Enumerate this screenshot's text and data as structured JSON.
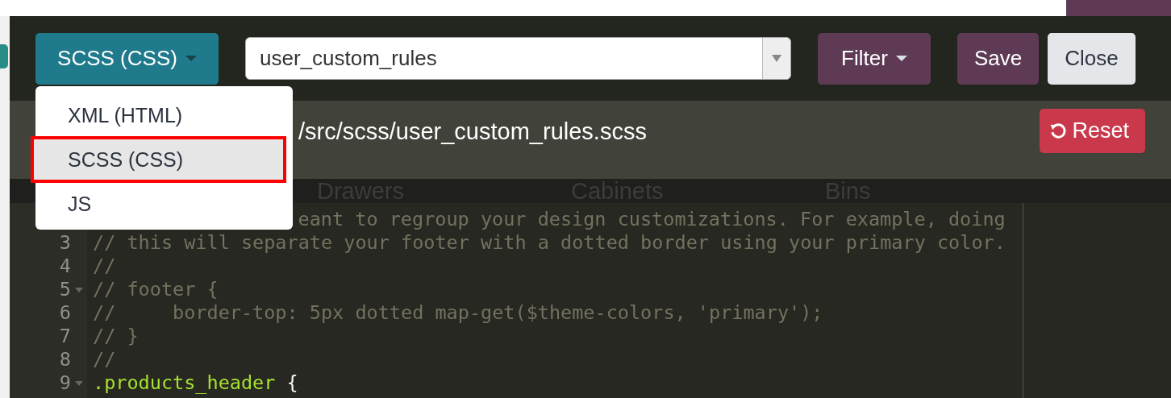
{
  "toolbar": {
    "language_button": {
      "label": "SCSS (CSS)"
    },
    "file_select": {
      "value": "user_custom_rules"
    },
    "buttons": [
      {
        "label": "Filter",
        "kind": "dropdown"
      },
      {
        "label": "Save",
        "kind": "primary"
      },
      {
        "label": "Close",
        "kind": "secondary"
      }
    ]
  },
  "language_menu": {
    "items": [
      {
        "label": "XML (HTML)",
        "selected": false,
        "highlighted": false
      },
      {
        "label": "SCSS (CSS)",
        "selected": true,
        "highlighted": true
      },
      {
        "label": "JS",
        "selected": false,
        "highlighted": false
      }
    ]
  },
  "file_path": "/src/scss/user_custom_rules.scss",
  "reset_button": {
    "label": "Reset"
  },
  "background_categories": [
    "Drawers",
    "Cabinets",
    "Bins"
  ],
  "editor": {
    "lines": [
      {
        "tokens": [
          {
            "text": "eant to regroup your design customizations. For example, doing",
            "kind": "comment"
          }
        ],
        "foldable": false,
        "offset": true
      },
      {
        "number": "3",
        "tokens": [
          {
            "text": "// this will separate your footer with a dotted border using your primary color.",
            "kind": "comment"
          }
        ],
        "foldable": false
      },
      {
        "number": "4",
        "tokens": [
          {
            "text": "//",
            "kind": "comment"
          }
        ],
        "foldable": false
      },
      {
        "number": "5",
        "tokens": [
          {
            "text": "// footer {",
            "kind": "comment"
          }
        ],
        "foldable": true
      },
      {
        "number": "6",
        "tokens": [
          {
            "text": "//     border-top: 5px dotted map-get($theme-colors, 'primary');",
            "kind": "comment"
          }
        ],
        "foldable": false
      },
      {
        "number": "7",
        "tokens": [
          {
            "text": "// }",
            "kind": "comment"
          }
        ],
        "foldable": false
      },
      {
        "number": "8",
        "tokens": [
          {
            "text": "//",
            "kind": "comment"
          }
        ],
        "foldable": false
      },
      {
        "number": "9",
        "tokens": [
          {
            "text": ".products_header",
            "kind": "selector"
          },
          {
            "text": " {",
            "kind": "plain"
          }
        ],
        "foldable": true
      }
    ]
  }
}
